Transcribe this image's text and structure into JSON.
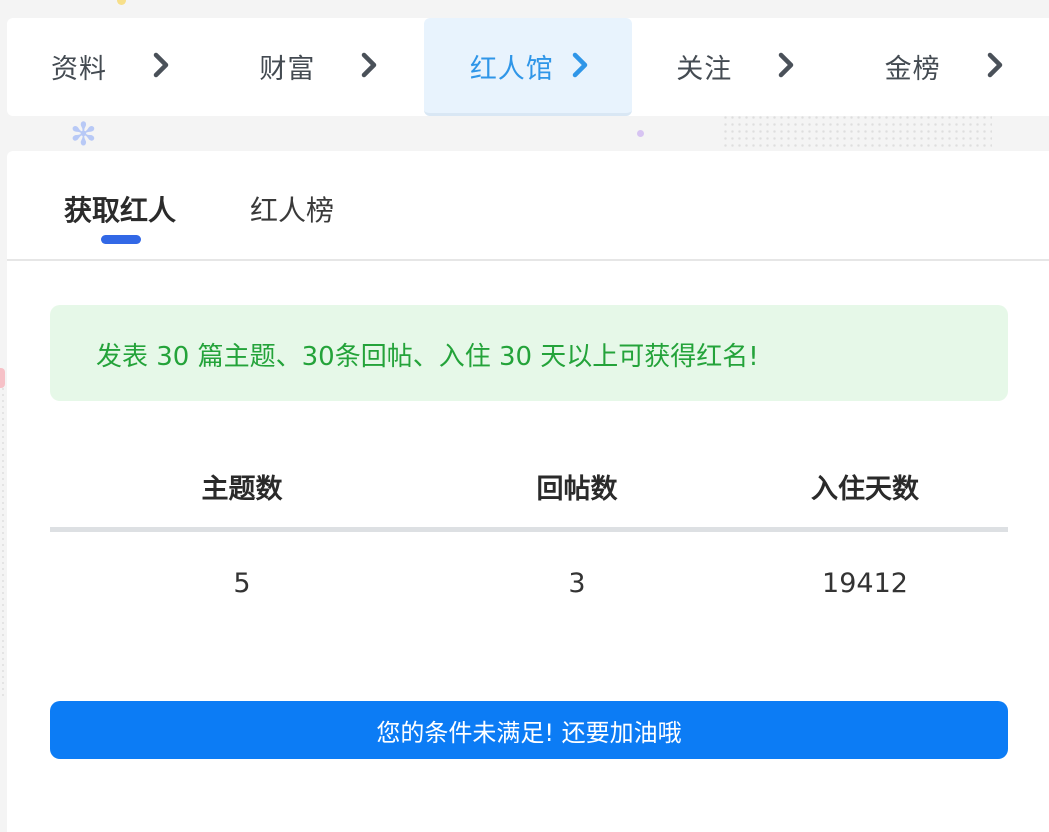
{
  "nav": {
    "items": [
      {
        "label": "资料",
        "icon": "chevron-right-icon"
      },
      {
        "label": "财富",
        "icon": "chevron-right-icon"
      },
      {
        "label": "红人馆",
        "icon": "chevron-right-icon",
        "active": true
      },
      {
        "label": "关注",
        "icon": "chevron-right-icon"
      },
      {
        "label": "金榜",
        "icon": "chevron-right-icon"
      }
    ]
  },
  "tabs": {
    "items": [
      {
        "label": "获取红人",
        "active": true
      },
      {
        "label": "红人榜",
        "active": false
      }
    ]
  },
  "notice": {
    "text": "发表 30 篇主题、30条回帖、入住 30 天以上可获得红名!"
  },
  "stats": {
    "headers": [
      "主题数",
      "回帖数",
      "入住天数"
    ],
    "values": [
      "5",
      "3",
      "19412"
    ]
  },
  "action": {
    "label": "您的条件未满足!  还要加油哦"
  },
  "colors": {
    "accent": "#2f96e8",
    "tab_indicator": "#3268e6",
    "notice_bg": "#e6f8e8",
    "notice_text": "#24a33a",
    "button": "#0c7cf5"
  }
}
